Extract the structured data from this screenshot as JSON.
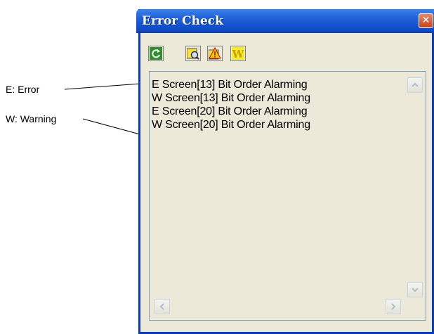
{
  "annotations": {
    "error_label": "E: Error",
    "warning_label": "W: Warning"
  },
  "window": {
    "title": "Error Check",
    "close_glyph": "✕"
  },
  "toolbar": {
    "buttons": [
      {
        "icon": "refresh-icon"
      },
      {
        "icon": "search-errors-icon"
      },
      {
        "icon": "alarm-warning-icon"
      },
      {
        "icon": "warning-w-icon",
        "glyph": "W"
      }
    ]
  },
  "list": {
    "items": [
      "E Screen[13] Bit Order Alarming",
      "W Screen[13] Bit Order Alarming",
      "E Screen[20] Bit Order Alarming",
      "W Screen[20] Bit Order Alarming"
    ]
  },
  "colors": {
    "titlebar": "#1e5fd8",
    "window_bg": "#ece9d8",
    "close_button": "#c8401b"
  }
}
